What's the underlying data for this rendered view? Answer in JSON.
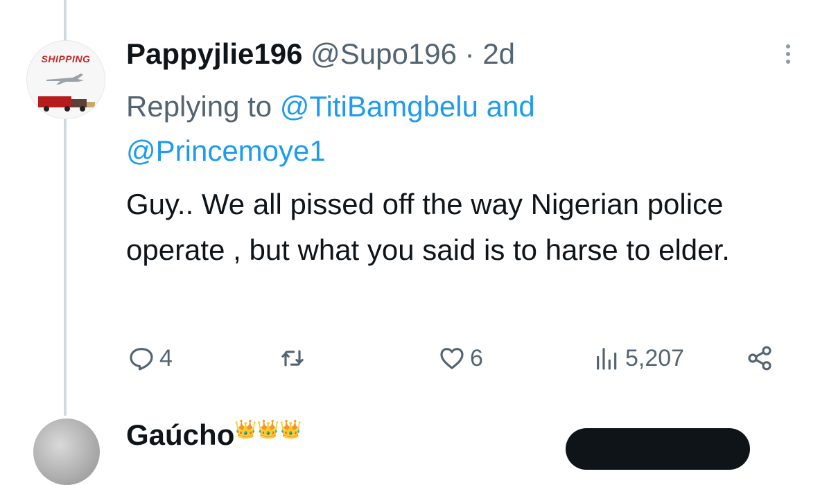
{
  "tweet": {
    "display_name": "Pappyjlie196",
    "handle": "@Supo196",
    "separator": "·",
    "time_ago": "2d",
    "replying_prefix": "Replying to",
    "reply_mention_1": "@TitiBamgbelu",
    "reply_and": "and",
    "reply_mention_2": "@Princemoye1",
    "body": "Guy.. We all pissed off the way Nigerian police operate , but what you said is to harse to elder.",
    "avatar_text": "SHIPPING"
  },
  "actions": {
    "reply_count": "4",
    "retweet_count": "",
    "like_count": "6",
    "view_count": "5,207"
  },
  "icons": {
    "reply": "reply-icon",
    "retweet": "retweet-icon",
    "like": "heart-icon",
    "views": "views-icon",
    "share": "share-icon",
    "more": "more-icon"
  },
  "next_tweet": {
    "display_name_partial": "Gaúcho",
    "emoji_text": "👑👑👑"
  },
  "colors": {
    "text": "#0f1419",
    "secondary": "#536471",
    "link": "#1d9bf0",
    "thread_line": "#cfd9de"
  }
}
